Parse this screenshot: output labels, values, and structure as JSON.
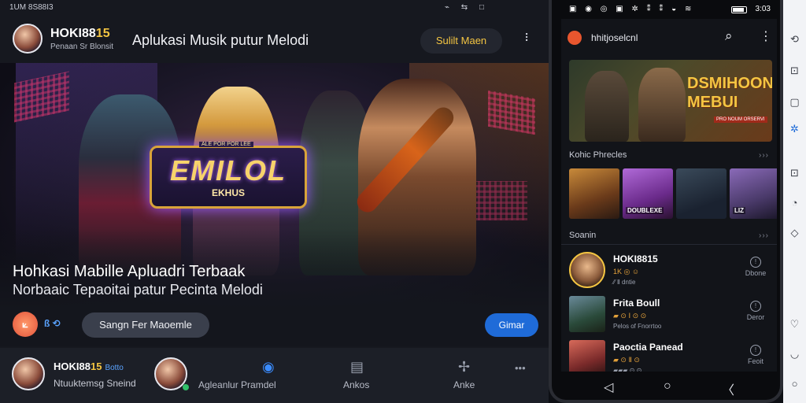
{
  "web": {
    "status_left": "1UM 8S88I3",
    "status_right": "⌁ ⇆ □",
    "header": {
      "brand_main": "HOKI88",
      "brand_highlight": "15",
      "brand_sub": "Penaan Sr Blonsit",
      "title": "Aplukasi Musik putur Melodi",
      "action_button": "Sulilt Maen",
      "more": "⠸"
    },
    "hero": {
      "logo_top": "ALE POR POR LEE",
      "logo_text": "EMILOL",
      "logo_sub": "EKHUS",
      "headline": "Hohkasi Mabille Apluadri Terbaak",
      "subheadline": "Norbaaic Tepaoitai patur Pecinta Melodi",
      "app_icon": "⟀",
      "badges": "ß ⟲",
      "pill_label": "Sangn Fer Maoemle",
      "cta_label": "Gimar"
    },
    "bottom_nav": {
      "user_main": "HOKI88",
      "user_highlight": "15",
      "user_tag": "Botto",
      "user_sub": "Ntuuktemsg Sneind",
      "item2_label": "Agleanlur Pramdel",
      "item3_label": "Ankos",
      "item4_label": "Anke",
      "more": "•••"
    }
  },
  "phone": {
    "status_icons": "▣ ◉ ◎ ▣ ✲ ⁑ ⁑ ◒ ≋",
    "time": "3:03",
    "appbar_title": "hhitjoselcnl",
    "banner_text": "DSMIHOON MEBUI",
    "banner_sub": "PRO NOUM ORSERVI",
    "section1": "Kohic Phrecles",
    "section2": "Soanin",
    "chevrons": "›››",
    "thumb_captions": [
      "",
      "DOUBLEXE",
      "",
      "LIZ"
    ],
    "rows": [
      {
        "name": "HOKI8815",
        "meta": "1K  ◎  ☺",
        "meta2": "⁄⁄ Ⅱ dntie",
        "right_label": "Dbone"
      },
      {
        "name": "Frita Boull",
        "meta": "▰ ⊙ Ⅰ ⊙ ⊙",
        "meta2": "Pelos of Fnorrtoo",
        "right_label": "Deror"
      },
      {
        "name": "Paoctia Panead",
        "meta": "▰ ⊙ Ⅱ ⊙",
        "meta2": "▰▰▰ ⊙ ⊙",
        "right_label": "Feoit"
      }
    ],
    "nav_back": "◁",
    "nav_home": "○",
    "nav_recent": "〈"
  },
  "rail": {
    "icons": [
      "⟲",
      "⊡",
      "▢",
      "▢",
      "✲",
      "⊡",
      "◔",
      "◇",
      "♡",
      "◡",
      "○"
    ]
  },
  "colors": {
    "accent_gold": "#f4c542",
    "accent_blue": "#1f6bd8",
    "bg_dark": "#16181f"
  }
}
